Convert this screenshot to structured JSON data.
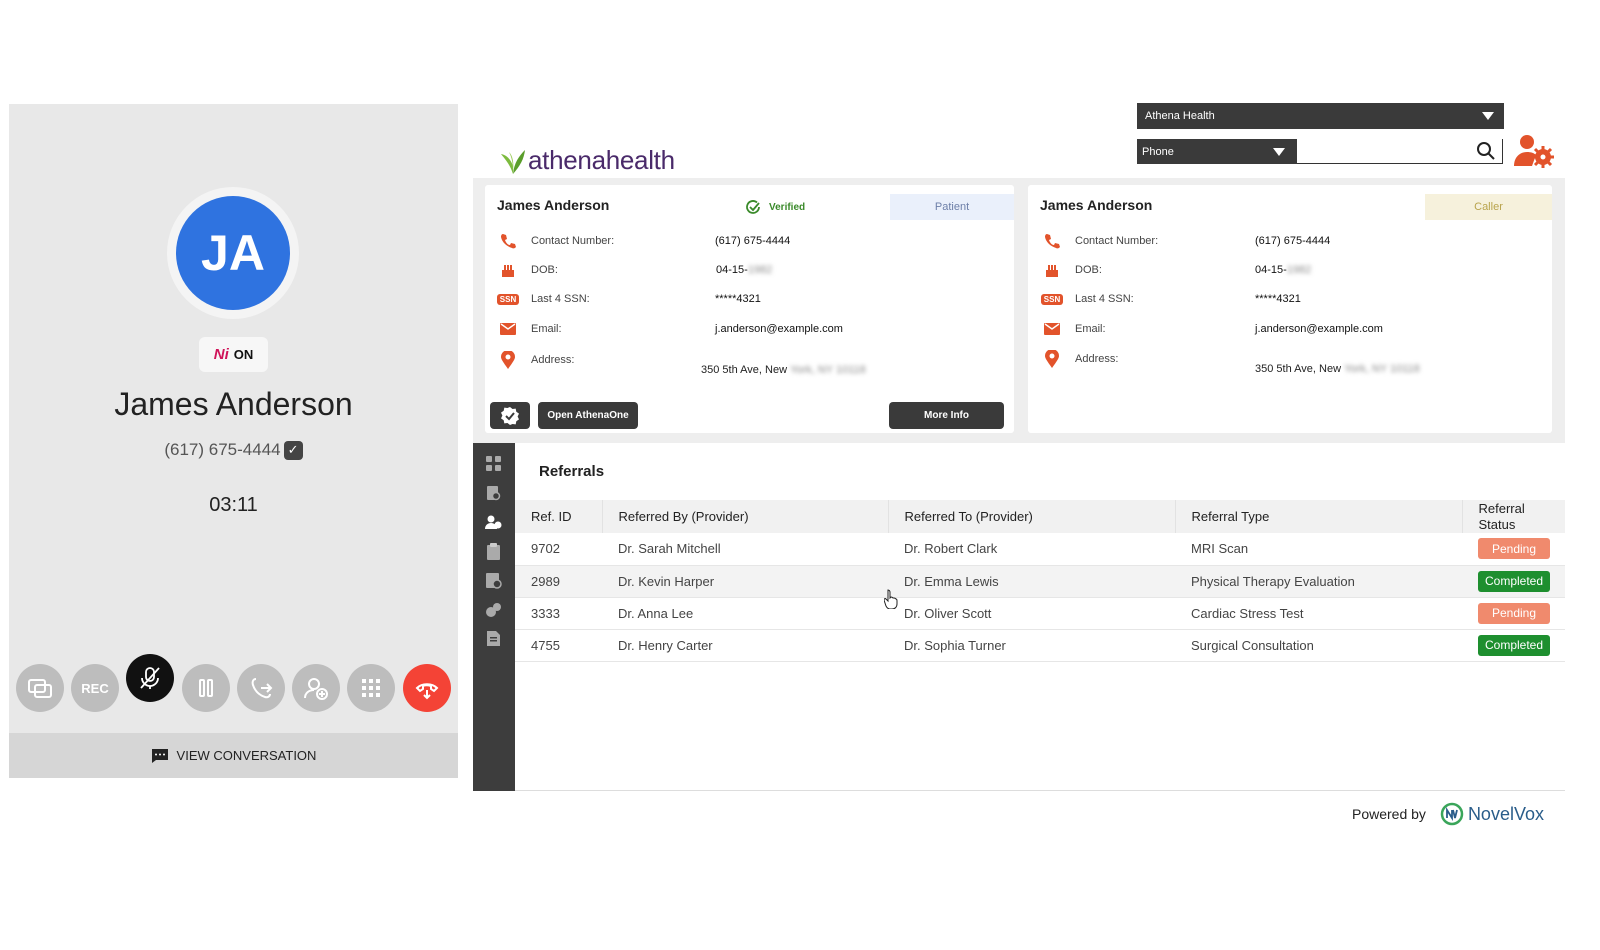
{
  "call": {
    "initials": "JA",
    "ai_badge_glyph": "Ni",
    "ai_badge_state": "ON",
    "caller_name": "James Anderson",
    "caller_phone": "(617) 675-4444",
    "timer": "03:11",
    "rec_label": "REC",
    "view_conversation": "VIEW CONVERSATION",
    "controls": [
      "switch-screen-icon",
      "rec",
      "mute-mic-icon",
      "pause-icon",
      "transfer-icon",
      "add-user-icon",
      "dialpad-icon",
      "hangup-icon"
    ]
  },
  "header": {
    "logo_text": "athenahealth",
    "crm_select": "Athena Health",
    "search_type": "Phone",
    "search_value": ""
  },
  "patient_card": {
    "name": "James Anderson",
    "verified_label": "Verified",
    "tag": "Patient",
    "labels": {
      "contact": "Contact Number:",
      "dob": "DOB:",
      "ssn": "Last 4 SSN:",
      "email": "Email:",
      "address": "Address:"
    },
    "contact": "(617) 675-4444",
    "dob_visible": "04-15-",
    "dob_hidden": "1982",
    "ssn_icon": "SSN",
    "ssn": "*****4321",
    "email": "j.anderson@example.com",
    "address_visible": "350 5th Ave, New",
    "address_hidden": "York, NY 10118",
    "open_button": "Open AthenaOne",
    "more_button": "More Info"
  },
  "caller_card": {
    "name": "James Anderson",
    "tag": "Caller",
    "labels": {
      "contact": "Contact Number:",
      "dob": "DOB:",
      "ssn": "Last 4 SSN:",
      "email": "Email:",
      "address": "Address:"
    },
    "contact": "(617) 675-4444",
    "dob_visible": "04-15-",
    "dob_hidden": "1982",
    "ssn_icon": "SSN",
    "ssn": "*****4321",
    "email": "j.anderson@example.com",
    "address_visible": "350 5th Ave, New",
    "address_hidden": "York, NY 10118"
  },
  "referrals": {
    "title": "Referrals",
    "columns": [
      "Ref. ID",
      "Referred By (Provider)",
      "Referred To (Provider)",
      "Referral Type",
      "Referral Status"
    ],
    "rows": [
      {
        "id": "9702",
        "by": "Dr. Sarah Mitchell",
        "to": "Dr. Robert Clark",
        "type": "MRI Scan",
        "status": "Pending"
      },
      {
        "id": "2989",
        "by": "Dr. Kevin Harper",
        "to": "Dr. Emma Lewis",
        "type": "Physical Therapy Evaluation",
        "status": "Completed"
      },
      {
        "id": "3333",
        "by": "Dr. Anna Lee",
        "to": "Dr. Oliver Scott",
        "type": "Cardiac Stress Test",
        "status": "Pending"
      },
      {
        "id": "4755",
        "by": "Dr. Henry Carter",
        "to": "Dr. Sophia Turner",
        "type": "Surgical Consultation",
        "status": "Completed"
      }
    ]
  },
  "footer": {
    "powered_by": "Powered by",
    "brand": "NovelVox"
  },
  "colors": {
    "avatar": "#2f73e0",
    "hangup": "#f44336",
    "pending": "#f08a6d",
    "completed": "#1e8f2f",
    "accent_orange": "#e2532b"
  }
}
